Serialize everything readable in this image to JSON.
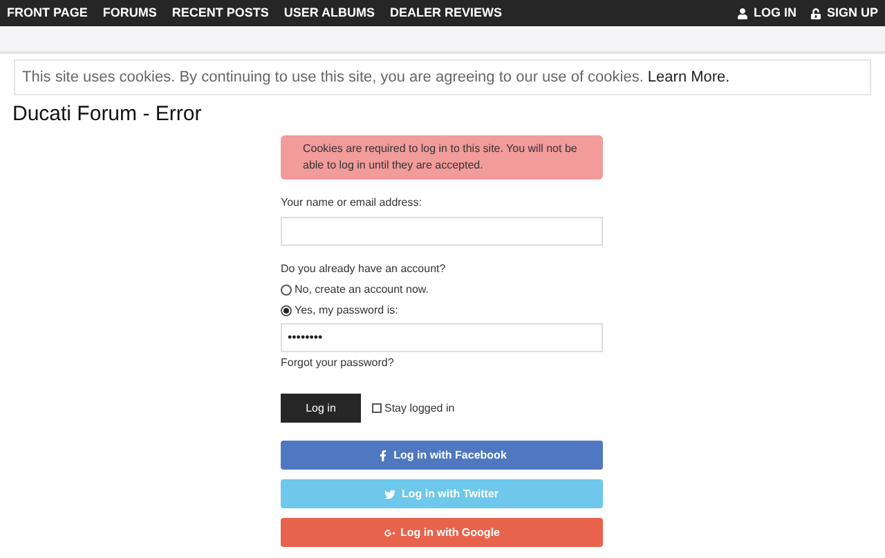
{
  "nav": {
    "items": [
      "FRONT PAGE",
      "FORUMS",
      "RECENT POSTS",
      "USER ALBUMS",
      "DEALER REVIEWS"
    ],
    "actions": [
      {
        "kind": "login",
        "label": "LOG IN"
      },
      {
        "kind": "signup",
        "label": "SIGN UP"
      }
    ]
  },
  "cookie_notice": {
    "text": "This site uses cookies. By continuing to use this site, you are agreeing to our use of cookies.",
    "link": "Learn More."
  },
  "title": "Ducati Forum - Error",
  "error": "Cookies are required to log in to this site. You will not be able to log in until they are accepted.",
  "form": {
    "name_label": "Your name or email address:",
    "account_question": "Do you already have an account?",
    "options": [
      {
        "label": "No, create an account now.",
        "selected": false
      },
      {
        "label": "Yes, my password is:",
        "selected": true
      }
    ],
    "password": "••••••••",
    "forgot": "Forgot your password?",
    "submit": "Log in",
    "stay_logged_in": {
      "label": "Stay logged in",
      "checked": false
    }
  },
  "social": [
    {
      "kind": "facebook",
      "label": "Log in with Facebook",
      "color": "#4f78c0"
    },
    {
      "kind": "twitter",
      "label": "Log in with Twitter",
      "color": "#6dc8ec"
    },
    {
      "kind": "google",
      "label": "Log in with Google",
      "color": "#e8634c"
    }
  ]
}
